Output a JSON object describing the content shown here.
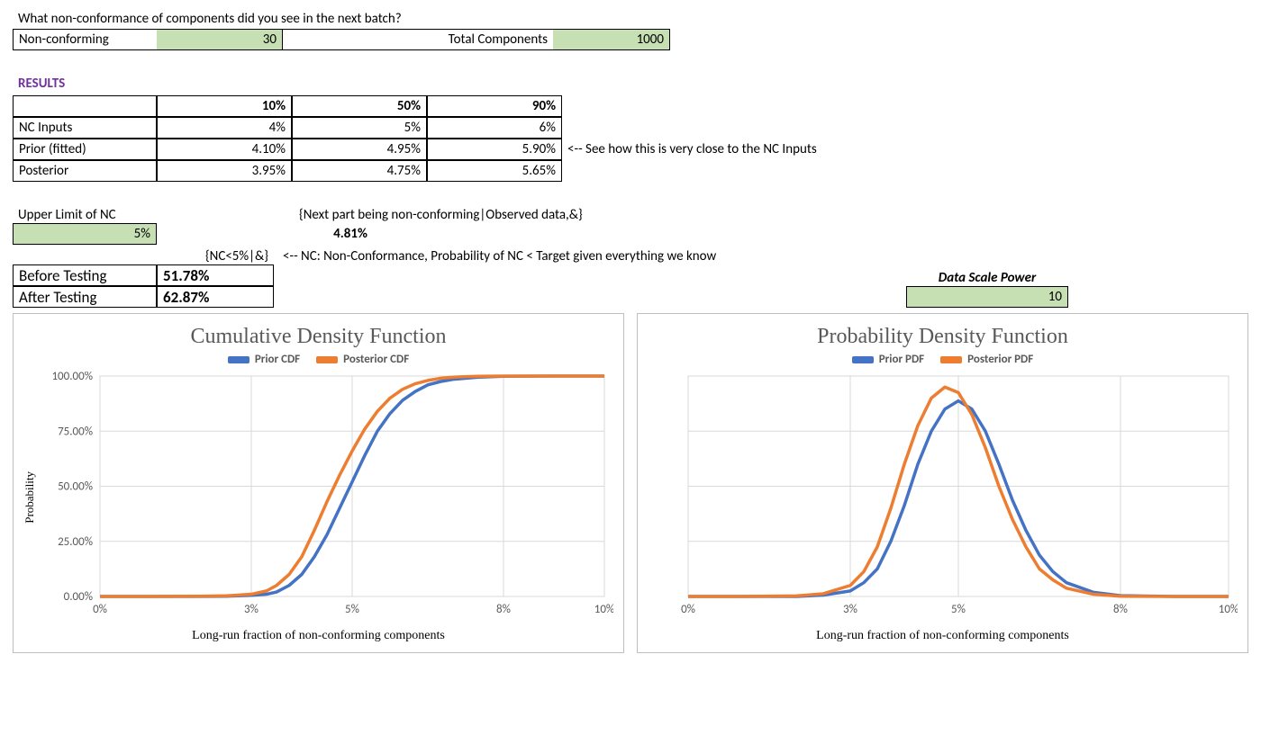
{
  "question": "What non-conformance of components did you see in the next batch?",
  "inputs": {
    "nc_label": "Non-conforming",
    "nc_value": "30",
    "total_label": "Total Components",
    "total_value": "1000"
  },
  "results_header": "RESULTS",
  "results": {
    "cols": [
      "10%",
      "50%",
      "90%"
    ],
    "rows": [
      {
        "label": "NC Inputs",
        "vals": [
          "4%",
          "5%",
          "6%"
        ]
      },
      {
        "label": "Prior (fitted)",
        "vals": [
          "4.10%",
          "4.95%",
          "5.90%"
        ]
      },
      {
        "label": "Posterior",
        "vals": [
          "3.95%",
          "4.75%",
          "5.65%"
        ]
      }
    ],
    "note": "<-- See how this is very close to the NC Inputs"
  },
  "upper": {
    "label": "Upper Limit of NC",
    "value": "5%",
    "next_label": "{Next part being non-conforming|Observed data,&}",
    "next_value": "4.81%"
  },
  "nc_cond": {
    "header": "{NC<5%|&}",
    "note": "<-- NC: Non-Conformance, Probability of NC < Target given everything we know",
    "rows": [
      {
        "label": "Before Testing",
        "val": "51.78%"
      },
      {
        "label": "After Testing",
        "val": "62.87%"
      }
    ]
  },
  "scale": {
    "label": "Data Scale Power",
    "value": "10"
  },
  "chart_data": [
    {
      "type": "line",
      "title": "Cumulative Density Function",
      "xlabel": "Long-run fraction of non-conforming components",
      "ylabel": "Probability",
      "x_ticks": [
        "0%",
        "3%",
        "5%",
        "8%",
        "10%"
      ],
      "y_ticks": [
        "0.00%",
        "25.00%",
        "50.00%",
        "75.00%",
        "100.00%"
      ],
      "xlim": [
        0,
        10
      ],
      "ylim": [
        0,
        100
      ],
      "x": [
        0,
        1,
        2,
        2.5,
        3,
        3.3,
        3.5,
        3.75,
        4,
        4.25,
        4.5,
        4.75,
        5,
        5.25,
        5.5,
        5.75,
        6,
        6.25,
        6.5,
        6.75,
        7,
        7.5,
        8,
        9,
        10
      ],
      "series": [
        {
          "name": "Prior CDF",
          "color": "#4472c4",
          "values": [
            0,
            0,
            0,
            0.1,
            0.5,
            1,
            2,
            5,
            10,
            18,
            28,
            40,
            52,
            64,
            75,
            83,
            89,
            93,
            96,
            97.5,
            98.5,
            99.5,
            99.9,
            100,
            100
          ]
        },
        {
          "name": "Posterior CDF",
          "color": "#ed7d31",
          "values": [
            0,
            0,
            0.1,
            0.3,
            1,
            2.5,
            5,
            10,
            18,
            30,
            43,
            55,
            66,
            76,
            84,
            90,
            94,
            96.5,
            98,
            99,
            99.5,
            99.9,
            100,
            100,
            100
          ]
        }
      ]
    },
    {
      "type": "line",
      "title": "Probability Density Function",
      "xlabel": "Long-run fraction of non-conforming components",
      "ylabel": "",
      "x_ticks": [
        "0%",
        "3%",
        "5%",
        "8%",
        "10%"
      ],
      "y_ticks_hidden": true,
      "xlim": [
        0,
        10
      ],
      "ylim": [
        0,
        80
      ],
      "x": [
        0,
        1,
        2,
        2.5,
        3,
        3.25,
        3.5,
        3.75,
        4,
        4.25,
        4.5,
        4.75,
        5,
        5.25,
        5.5,
        5.75,
        6,
        6.25,
        6.5,
        6.75,
        7,
        7.5,
        8,
        9,
        10
      ],
      "series": [
        {
          "name": "Prior PDF",
          "color": "#4472c4",
          "values": [
            0,
            0,
            0,
            0.5,
            2,
            5,
            10,
            20,
            33,
            48,
            60,
            68,
            71,
            68,
            60,
            48,
            35,
            24,
            15,
            9,
            5,
            1.5,
            0.3,
            0,
            0
          ]
        },
        {
          "name": "Posterior PDF",
          "color": "#ed7d31",
          "values": [
            0,
            0,
            0.2,
            1,
            4,
            9,
            18,
            32,
            48,
            62,
            72,
            76,
            74,
            66,
            54,
            40,
            28,
            18,
            10,
            6,
            3,
            0.8,
            0.1,
            0,
            0
          ]
        }
      ]
    }
  ]
}
